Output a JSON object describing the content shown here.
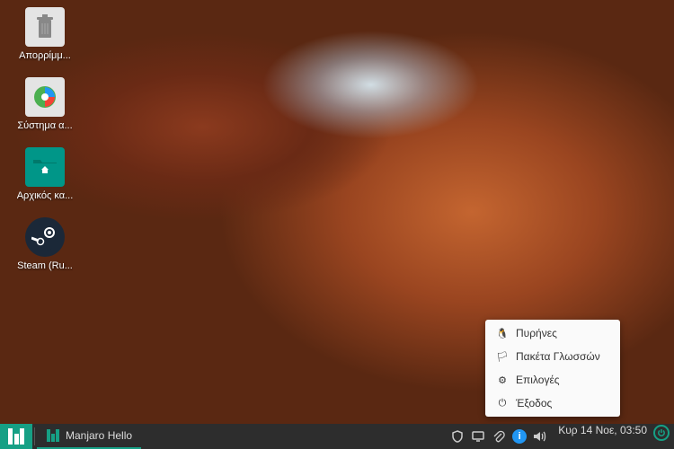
{
  "desktop": {
    "icons": [
      {
        "name": "trash",
        "label": "Απορρίμμ..."
      },
      {
        "name": "system",
        "label": "Σύστημα α..."
      },
      {
        "name": "home",
        "label": "Αρχικός κα..."
      },
      {
        "name": "steam",
        "label": "Steam (Ru..."
      }
    ]
  },
  "context_menu": {
    "items": [
      {
        "icon": "🐧",
        "label": "Πυρήνες"
      },
      {
        "icon": "🏳",
        "label": "Πακέτα Γλωσσών"
      },
      {
        "icon": "⚙",
        "label": "Επιλογές"
      },
      {
        "icon": "⏻",
        "label": "Έξοδος"
      }
    ]
  },
  "taskbar": {
    "active_window": "Manjaro Hello",
    "clock": "Κυρ 14 Νοε, 03:50",
    "tray_icons": [
      "shield",
      "desktop",
      "attachment",
      "info",
      "volume"
    ]
  }
}
